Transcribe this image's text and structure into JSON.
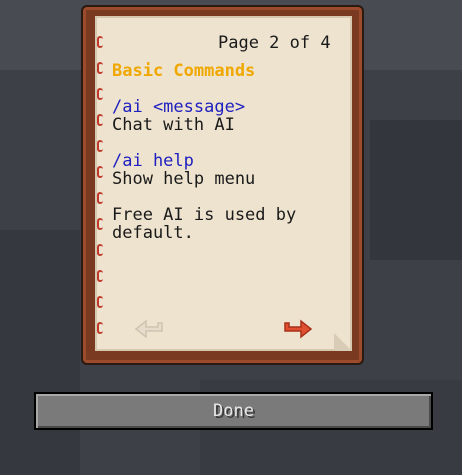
{
  "book": {
    "page_counter": "Page 2 of 4",
    "title": "Basic Commands",
    "entries": [
      {
        "command": "/ai <message>",
        "description": "Chat with AI"
      },
      {
        "command": "/ai help",
        "description": "Show help menu"
      }
    ],
    "note_line1": "Free AI is used by",
    "note_line2": "default.",
    "prev_icon": "previous-page-arrow-icon",
    "next_icon": "next-page-arrow-icon"
  },
  "buttons": {
    "done_label": "Done"
  },
  "colors": {
    "background": "#3d4047",
    "cover": "#7a3a22",
    "page": "#ede3cf",
    "title": "#f0a800",
    "command": "#2020c0",
    "next_arrow": "#e05030",
    "prev_arrow": "#e6dccb",
    "button": "#7a7a7a",
    "button_text": "#e8e8e8"
  }
}
